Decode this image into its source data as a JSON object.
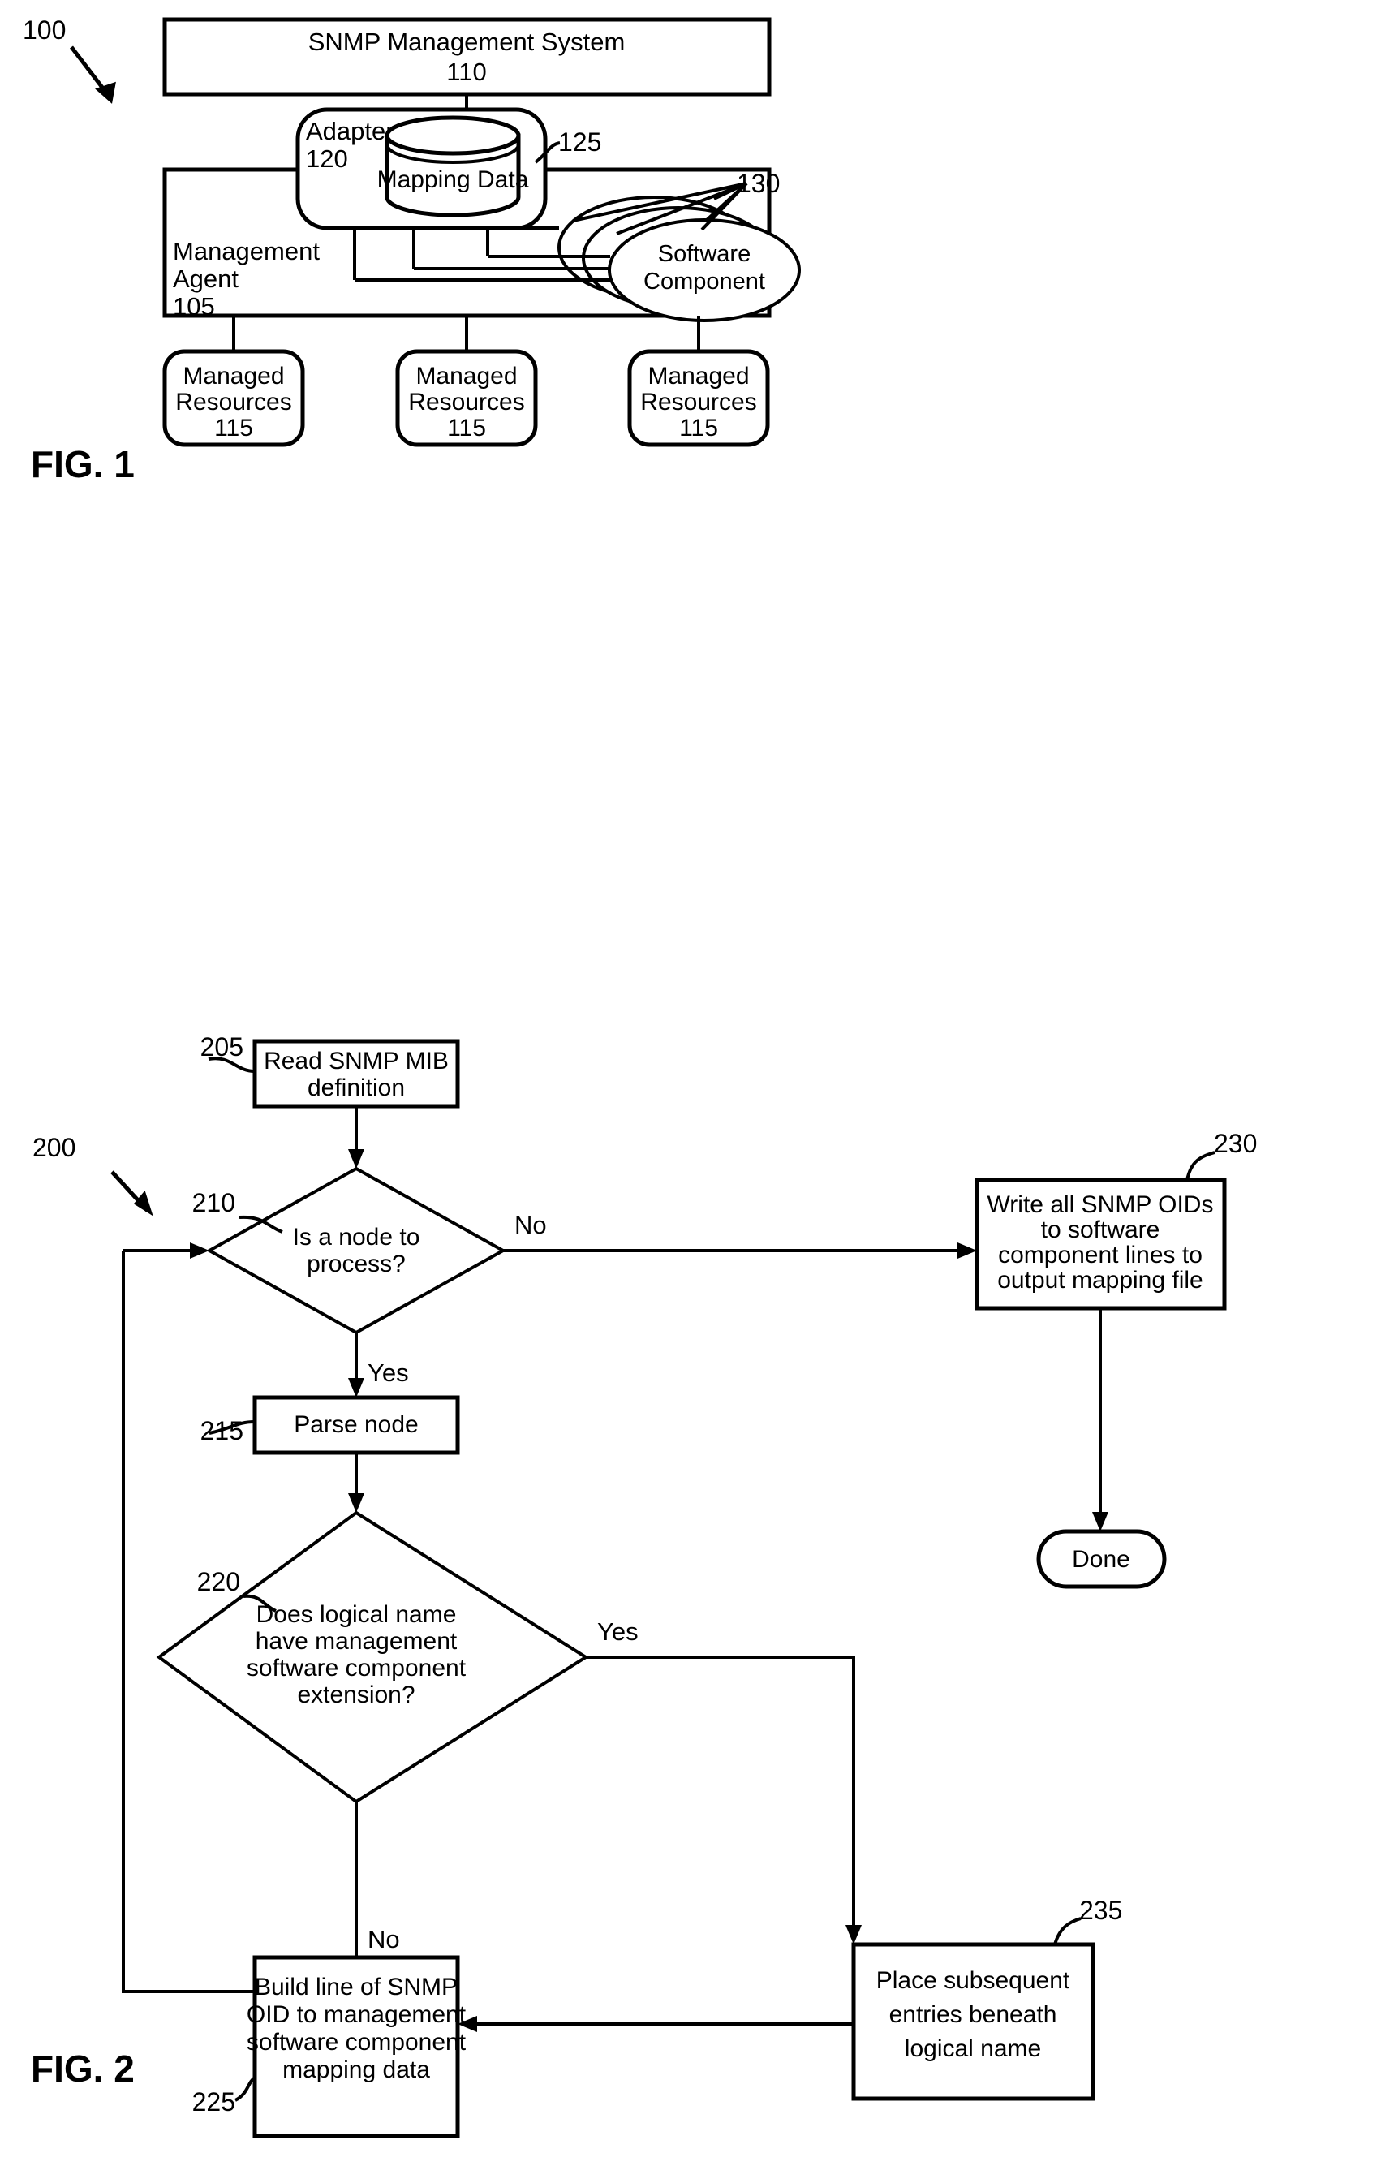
{
  "figures": [
    {
      "id": "fig1",
      "label": "FIG. 1",
      "ref": "100",
      "nodes": {
        "snmp_system": {
          "title": "SNMP Management System",
          "ref": "110"
        },
        "adapter": {
          "title": "Adapter",
          "ref": "120"
        },
        "mapping_data": {
          "title": "Mapping Data",
          "ref": "125"
        },
        "management_agent": {
          "title_line1": "Management",
          "title_line2": "Agent",
          "ref": "105"
        },
        "software_component": {
          "title_line1": "Software",
          "title_line2": "Component",
          "ref": "130"
        },
        "managed_resources_1": {
          "title_line1": "Managed",
          "title_line2": "Resources",
          "ref": "115"
        },
        "managed_resources_2": {
          "title_line1": "Managed",
          "title_line2": "Resources",
          "ref": "115"
        },
        "managed_resources_3": {
          "title_line1": "Managed",
          "title_line2": "Resources",
          "ref": "115"
        }
      }
    },
    {
      "id": "fig2",
      "label": "FIG. 2",
      "ref": "200",
      "nodes": {
        "read_mib": {
          "line1": "Read SNMP MIB",
          "line2": "definition",
          "ref": "205"
        },
        "is_node": {
          "line1": "Is a node to",
          "line2": "process?",
          "ref": "210"
        },
        "parse_node": {
          "line1": "Parse node",
          "ref": "215"
        },
        "write_oids": {
          "line1": "Write all SNMP OIDs",
          "line2": "to software",
          "line3": "component lines to",
          "line4": "output mapping file",
          "ref": "230"
        },
        "done": {
          "line1": "Done"
        },
        "has_extension": {
          "line1": "Does logical name",
          "line2": "have management",
          "line3": "software component",
          "line4": "extension?",
          "ref": "220"
        },
        "build_line": {
          "line1": "Build line of SNMP",
          "line2": "OID to management",
          "line3": "software component",
          "line4": "mapping data",
          "ref": "225"
        },
        "place_entries": {
          "line1": "Place subsequent",
          "line2": "entries beneath",
          "line3": "logical name",
          "ref": "235"
        }
      },
      "edge_labels": {
        "is_node_no": "No",
        "is_node_yes": "Yes",
        "has_extension_yes": "Yes",
        "has_extension_no": "No"
      }
    }
  ],
  "colors": {
    "ink": "#000000",
    "paper": "#ffffff"
  }
}
